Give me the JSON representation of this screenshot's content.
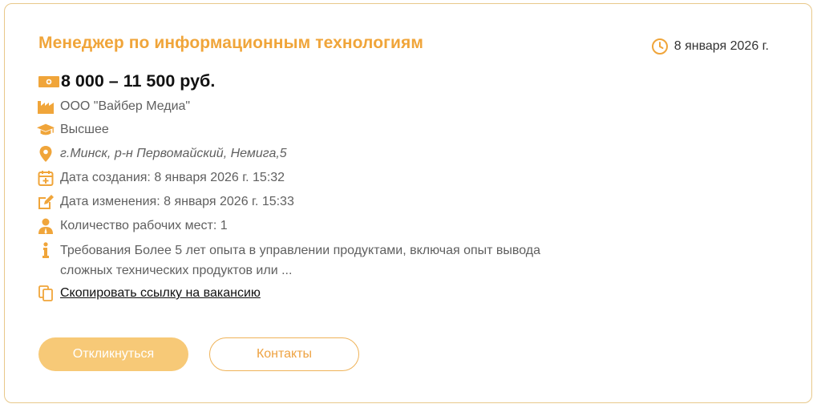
{
  "vacancy": {
    "title": "Менеджер по информационным технологиям",
    "date": "8 января 2026 г.",
    "salary": "8 000 – 11 500 руб.",
    "company": "ООО \"Вайбер Медиа\"",
    "education": "Высшее",
    "address": "г.Минск, р-н Первомайский, Немига,5",
    "created": "Дата создания: 8 января 2026 г. 15:32",
    "modified": "Дата изменения: 8 января 2026 г. 15:33",
    "workplaces": "Количество рабочих мест: 1",
    "requirements": "Требования Более 5 лет опыта в управлении продуктами, включая опыт вывода сложных технических продуктов или ...",
    "copy_link": "Скопировать ссылку на вакансию"
  },
  "actions": {
    "apply_label": "Откликнуться",
    "contacts_label": "Контакты"
  },
  "colors": {
    "accent": "#f0a53a",
    "button_fill": "#f7c977",
    "border": "#e8c88a"
  },
  "icons": [
    "clock-icon",
    "money-icon",
    "factory-icon",
    "graduation-cap-icon",
    "location-pin-icon",
    "calendar-plus-icon",
    "edit-icon",
    "person-icon",
    "info-icon",
    "copy-icon"
  ]
}
